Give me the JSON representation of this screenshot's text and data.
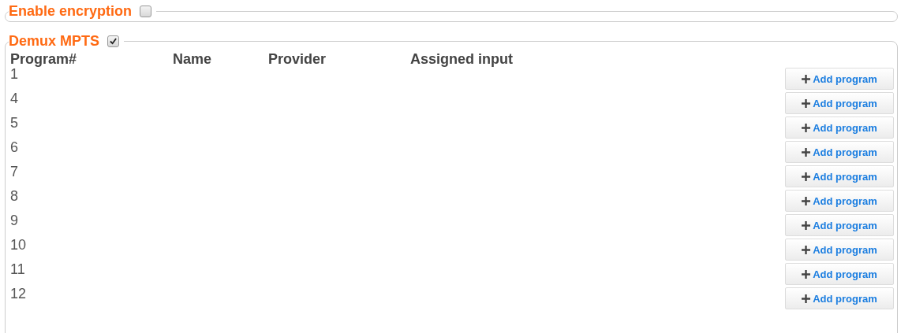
{
  "sections": [
    {
      "legend": "Enable encryption",
      "checked": false
    },
    {
      "legend": "Demux MPTS",
      "checked": true,
      "table": {
        "columns": [
          "Program#",
          "Name",
          "Provider",
          "Assigned input"
        ],
        "rows": [
          {
            "program": "1",
            "action": "Add program"
          },
          {
            "program": "4",
            "action": "Add program"
          },
          {
            "program": "5",
            "action": "Add program"
          },
          {
            "program": "6",
            "action": "Add program"
          },
          {
            "program": "7",
            "action": "Add program"
          },
          {
            "program": "8",
            "action": "Add program"
          },
          {
            "program": "9",
            "action": "Add program"
          },
          {
            "program": "10",
            "action": "Add program"
          },
          {
            "program": "11",
            "action": "Add program"
          },
          {
            "program": "12",
            "action": "Add program"
          }
        ]
      }
    }
  ]
}
